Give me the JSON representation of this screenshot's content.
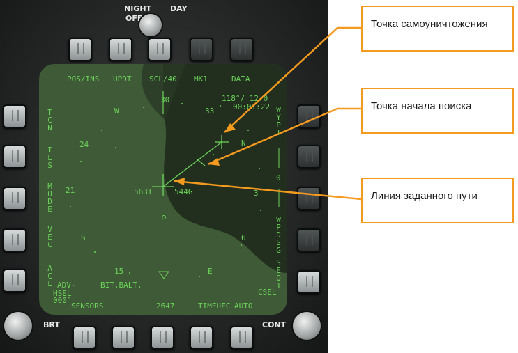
{
  "cockpit": {
    "night_day_label": "NIGHT",
    "day_label": "DAY",
    "off_label": "OFF",
    "brt_label": "BRT",
    "cont_label": "CONT"
  },
  "mfd": {
    "top_options": [
      "POS/INS",
      "UPDT",
      "SCL/40",
      "MK1",
      "DATA"
    ],
    "left_options": [
      "TCN",
      "ILS",
      "MODE",
      "VEC",
      "ACL"
    ],
    "right_options": [
      "WYPT",
      "WPDSG",
      "SEQ1"
    ],
    "bottom_options": [
      "SENSORS",
      "2647",
      "TIMEUFC",
      "AUTO"
    ],
    "bearing_range": "118°/ 12.0",
    "time": "00:01:22",
    "compass": {
      "n30": "30",
      "w": "W",
      "n33": "33",
      "n24": "24",
      "n21": "21",
      "s": "S",
      "n15": "15",
      "e": "E",
      "n6": "6",
      "n3": "3",
      "ne": "N"
    },
    "speed_t": "563T",
    "speed_g": "544G",
    "adv": "ADV-",
    "bit": "BIT,BALT,",
    "hsel": "HSEL",
    "hsel_val": "000°",
    "csel": "CSEL",
    "scroll_val": "0"
  },
  "callouts": [
    "Точка самоуничтожения",
    "Точка начала поиска",
    "Линия заданного пути"
  ],
  "colors": {
    "screen_text": "#6cd35a",
    "callout_border": "#f39a1f",
    "arrow": "#f39a1f"
  }
}
